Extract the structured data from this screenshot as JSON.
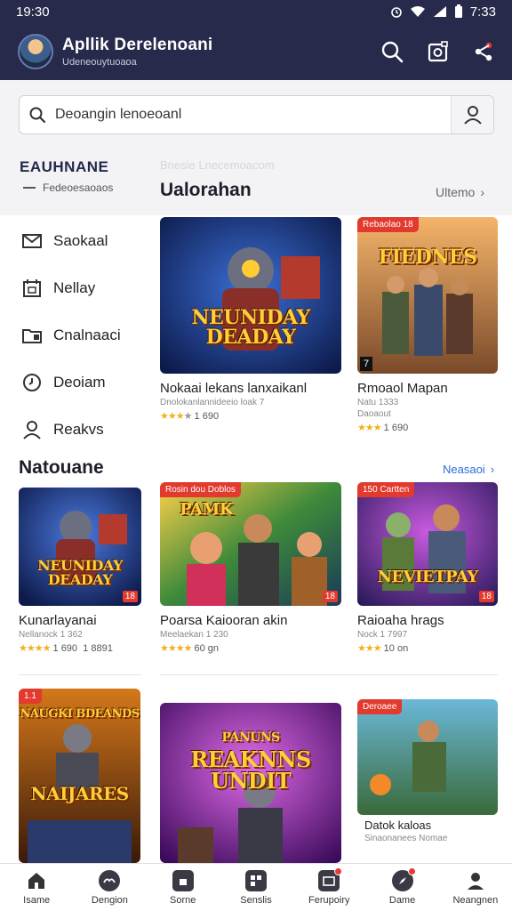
{
  "status_bar": {
    "time_left": "19:30",
    "time_right": "7:33"
  },
  "header": {
    "title": "Apllik Derelenoani",
    "subtitle": "Udeneouytuoaoa",
    "icons": [
      "search-icon",
      "camera-icon",
      "share-icon"
    ]
  },
  "search": {
    "value": "Deoangin lenoeoanl",
    "button_icon": "user-search-icon"
  },
  "sidebar": {
    "heading": "EAUHNANE",
    "subheading": "Fedeoesaoaos",
    "faint_heading": "Bnesie Lnecemoacom",
    "items": [
      {
        "label": "Saokaal",
        "icon": "mail-icon"
      },
      {
        "label": "Nellay",
        "icon": "calendar-icon"
      },
      {
        "label": "Cnalnaaci",
        "icon": "folder-icon"
      },
      {
        "label": "Deoiam",
        "icon": "clock-icon"
      },
      {
        "label": "Reakvs",
        "icon": "user-icon"
      }
    ]
  },
  "featured": {
    "title": "Ualorahan",
    "see_all": "Ultemo",
    "cards": [
      {
        "title": "Nokaai lekans lanxaikanl",
        "meta": "Dnolokanlannideeio loak 7",
        "rating": "1 690",
        "art": "NEUNIDAY DEADAY"
      },
      {
        "title": "Rmoaol Mapan",
        "meta": "Natu 1333",
        "meta2": "Daoaout",
        "rating": "1 690",
        "badge": "Rebaolao 18",
        "age": "7",
        "art": "FIEDNES"
      }
    ]
  },
  "section2": {
    "title": "Natouane",
    "see_all": "Neasaoi",
    "cards": [
      {
        "title": "Kunarlayanai",
        "meta": "Nellanock 1 362",
        "rating": "1 690",
        "rating_extra": "1 8891",
        "corner": "18",
        "art": "NEUNIDAY DEADAY"
      },
      {
        "title": "Poarsa Kaiooran akin",
        "meta": "Meelaekan 1 230",
        "rating": "60 gn",
        "badge": "Rosin dou Doblos",
        "corner": "18",
        "art": "PAMK"
      },
      {
        "title": "Raioaha hrags",
        "meta": "Nock 1 7997",
        "rating": "10 on",
        "badge": "150 Cartten",
        "corner": "18",
        "art": "NEVIETPAY"
      }
    ]
  },
  "section3": {
    "cards": [
      {
        "badge": "1.1",
        "art": "NAIJARES",
        "art_top": "NAUGKI BDEANDS"
      },
      {
        "art": "REAKNNS UNDIT",
        "art_top": "PANUNS"
      },
      {
        "title": "Datok kaloas",
        "meta": "Sinaonanees Nomae",
        "badge": "Deroaee"
      }
    ]
  },
  "bottom_nav": [
    {
      "label": "Isame",
      "icon": "home-icon"
    },
    {
      "label": "Dengion",
      "icon": "gamepad-icon"
    },
    {
      "label": "Sorne",
      "icon": "store-icon"
    },
    {
      "label": "Senslis",
      "icon": "grid-icon"
    },
    {
      "label": "Ferupoiry",
      "icon": "library-icon",
      "dot": true
    },
    {
      "label": "Dame",
      "icon": "compass-icon",
      "dot": true
    },
    {
      "label": "Neangnen",
      "icon": "profile-icon"
    }
  ],
  "colors": {
    "header_bg": "#272a4a",
    "badge_red": "#e23a2e",
    "star": "#f2b01e",
    "link_blue": "#2a6fd6"
  }
}
